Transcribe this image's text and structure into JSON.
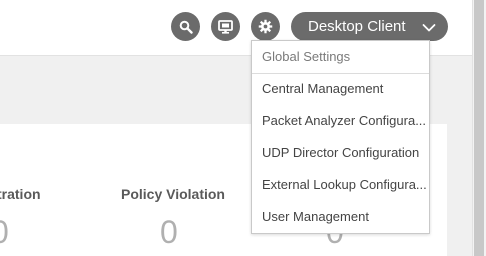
{
  "header": {
    "client_label": "Desktop Client",
    "icons": {
      "search": "search-icon",
      "desktop": "monitor-icon",
      "settings": "gear-icon",
      "chevron": "chevron-down-icon"
    }
  },
  "settings_menu": {
    "header": "Global Settings",
    "items": [
      "Central Management",
      "Packet Analyzer Configura...",
      "UDP Director Configuration",
      "External Lookup Configura...",
      "User Management"
    ]
  },
  "metrics": [
    {
      "label": "tration",
      "value": "0"
    },
    {
      "label": "Policy Violation",
      "value": "0"
    },
    {
      "label": "",
      "value": "0"
    }
  ],
  "colors": {
    "button_bg": "#6b6b6b",
    "content_bg": "#f0f0f0",
    "metric_value": "#b0b0b0"
  }
}
